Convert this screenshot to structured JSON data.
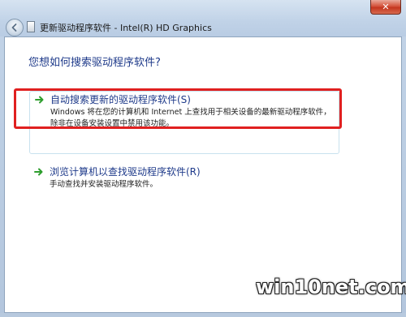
{
  "window": {
    "title": "更新驱动程序软件 - Intel(R) HD Graphics",
    "close_label": "✕"
  },
  "heading": "您想如何搜索驱动程序软件?",
  "options": [
    {
      "title": "自动搜索更新的驱动程序软件(S)",
      "description": "Windows 将在您的计算机和 Internet 上查找用于相关设备的最新驱动程序软件，除非在设备安装设置中禁用该功能。"
    },
    {
      "title": "浏览计算机以查找驱动程序软件(R)",
      "description": "手动查找并安装驱动程序软件。"
    }
  ],
  "watermark": "win10net.com",
  "colors": {
    "accent_text": "#1e3a8a",
    "highlight": "#e02020",
    "arrow_green": "#2e9e2e"
  }
}
